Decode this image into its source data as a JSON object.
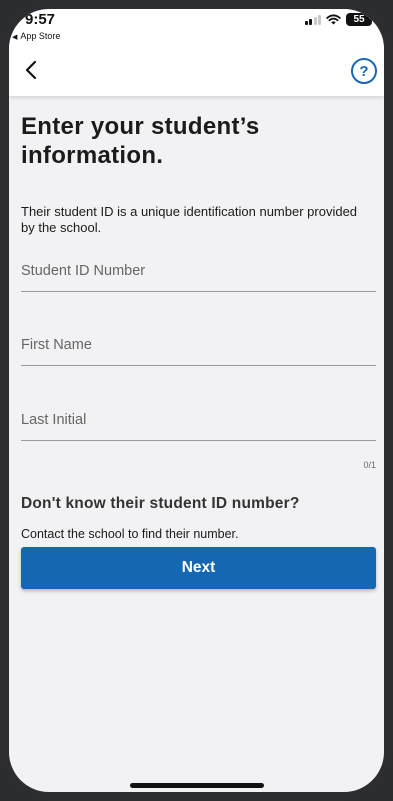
{
  "status_bar": {
    "time": "9:57",
    "back_app": "App Store",
    "battery": "55"
  },
  "nav": {
    "back_icon": "chevron-left-icon",
    "help_icon": "question-circle-icon",
    "help_symbol": "?"
  },
  "page": {
    "title": "Enter your student’s information.",
    "description": "Their student ID is a unique identification number provided by the school."
  },
  "form": {
    "student_id": {
      "placeholder": "Student ID Number",
      "value": ""
    },
    "first_name": {
      "placeholder": "First Name",
      "value": ""
    },
    "last_initial": {
      "placeholder": "Last Initial",
      "value": ""
    },
    "counter": "0/1"
  },
  "help": {
    "heading": "Don't know their student ID number?",
    "text": "Contact the school to find their number."
  },
  "next_label": "Next",
  "colors": {
    "accent": "#1667b2",
    "background": "#f2f2f4"
  }
}
